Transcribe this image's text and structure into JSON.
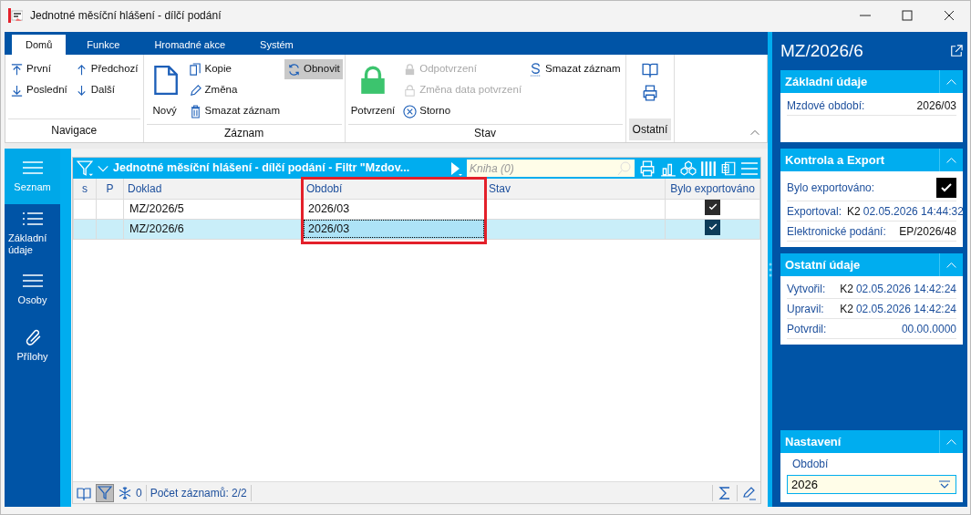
{
  "window": {
    "title": "Jednotné měsíční hlášení - dílčí podání"
  },
  "ribbon": {
    "tabs": [
      {
        "label": "Domů",
        "selected": true
      },
      {
        "label": "Funkce",
        "selected": false
      },
      {
        "label": "Hromadné akce",
        "selected": false
      },
      {
        "label": "Systém",
        "selected": false
      }
    ],
    "groups": [
      {
        "label": "Navigace",
        "items": [
          {
            "label": "První"
          },
          {
            "label": "Předchozí"
          },
          {
            "label": "Poslední"
          },
          {
            "label": "Další"
          }
        ]
      },
      {
        "label": "Záznam",
        "items": [
          {
            "label": "Nový",
            "pressed": false
          },
          {
            "label": "Kopie",
            "pressed": false
          },
          {
            "label": "Změna",
            "pressed": false
          },
          {
            "label": "Smazat záznam",
            "pressed": false
          },
          {
            "label": "Obnovit",
            "pressed": true
          }
        ]
      },
      {
        "label": "Stav",
        "items": [
          {
            "label": "Potvrzení",
            "disabled": false
          },
          {
            "label": "Odpotvrzení",
            "disabled": true
          },
          {
            "label": "Změna data potvrzení",
            "disabled": true
          },
          {
            "label": "Storno",
            "disabled": false
          },
          {
            "label": "Smazat záznam",
            "disabled": false
          }
        ]
      },
      {
        "label": "Ostatní"
      }
    ]
  },
  "nav": [
    {
      "label": "Seznam",
      "selected": true
    },
    {
      "label": "Základní údaje",
      "selected": false
    },
    {
      "label": "Osoby",
      "selected": false
    },
    {
      "label": "Přílohy",
      "selected": false
    }
  ],
  "grid": {
    "title": "Jednotné měsíční hlášení - dílčí podání - Filtr \"Mzdov...",
    "search": {
      "placeholder": "Kniha (0)"
    },
    "columns": [
      "s",
      "P",
      "Doklad",
      "Období",
      "Stav",
      "Bylo exportováno"
    ],
    "rows": [
      {
        "s": "",
        "p": "",
        "doklad": "MZ/2026/5",
        "obdobi": "2026/03",
        "stav": "",
        "exported": true,
        "selected": false
      },
      {
        "s": "",
        "p": "",
        "doklad": "MZ/2026/6",
        "obdobi": "2026/03",
        "stav": "",
        "exported": true,
        "selected": true
      }
    ],
    "status": {
      "frozen_count": "0",
      "record_count": "Počet záznamů: 2/2"
    }
  },
  "detail": {
    "title": "MZ/2026/6",
    "sections": [
      {
        "title": "Základní údaje",
        "expanded": true,
        "fields": [
          {
            "kind": "text",
            "label": "Mzdové období:",
            "value": "2026/03"
          }
        ]
      },
      {
        "title": "Kontrola a Export",
        "expanded": true,
        "fields": [
          {
            "kind": "check",
            "label": "Bylo exportováno:",
            "checked": true
          },
          {
            "kind": "user",
            "label": "Exportoval:",
            "user": "K2",
            "value": "02.05.2026 14:44:32"
          },
          {
            "kind": "text",
            "label": "Elektronické podání:",
            "value": "EP/2026/48"
          }
        ]
      },
      {
        "title": "Ostatní údaje",
        "expanded": true,
        "fields": [
          {
            "kind": "user",
            "label": "Vytvořil:",
            "user": "K2",
            "value": "02.05.2026 14:42:24"
          },
          {
            "kind": "user",
            "label": "Upravil:",
            "user": "K2",
            "value": "02.05.2026 14:42:24"
          },
          {
            "kind": "date",
            "label": "Potvrdil:",
            "value": "00.00.0000"
          }
        ]
      }
    ],
    "settings": {
      "title": "Nastavení",
      "expanded": true,
      "fields": [
        {
          "kind": "input",
          "label": "Období",
          "value": "2026"
        }
      ]
    }
  }
}
